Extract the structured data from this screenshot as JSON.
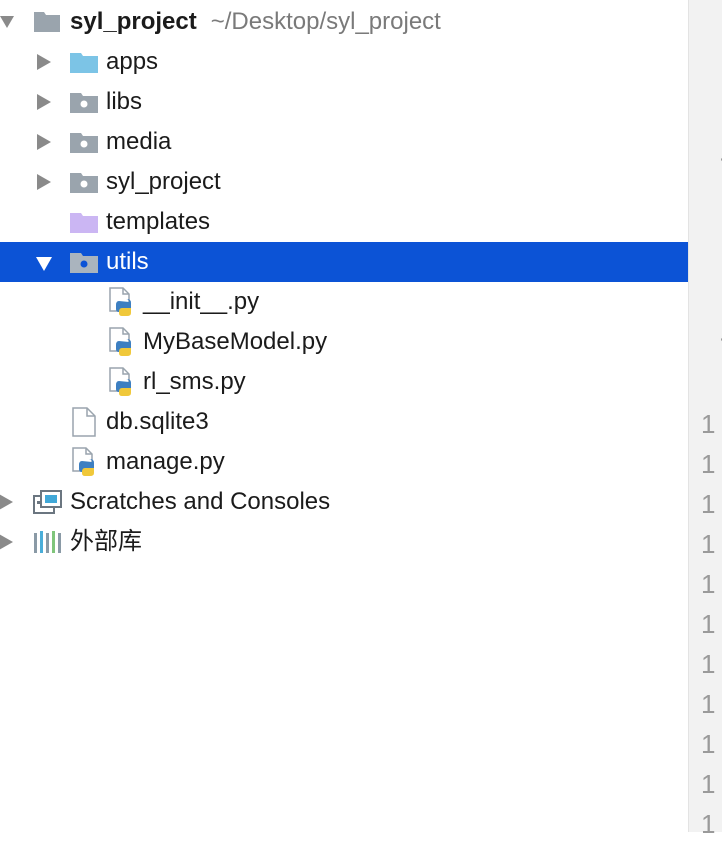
{
  "project_tree": {
    "root": {
      "name": "syl_project",
      "path": "~/Desktop/syl_project"
    },
    "items": [
      {
        "label": "apps"
      },
      {
        "label": "libs"
      },
      {
        "label": "media"
      },
      {
        "label": "syl_project"
      },
      {
        "label": "templates"
      },
      {
        "label": "utils"
      },
      {
        "label": "__init__.py"
      },
      {
        "label": "MyBaseModel.py"
      },
      {
        "label": "rl_sms.py"
      },
      {
        "label": "db.sqlite3"
      },
      {
        "label": "manage.py"
      },
      {
        "label": "Scratches and Consoles"
      },
      {
        "label": "外部库"
      }
    ],
    "selected_item": "utils"
  },
  "editor_gutter": {
    "line_numbers": [
      "1",
      "1",
      "1",
      "1",
      "1",
      "1",
      "1",
      "1",
      "1",
      "1",
      "1"
    ]
  },
  "colors": {
    "selection": "#0c53d6",
    "folder_gray": "#9aa4ad",
    "folder_blue": "#7cc4e6",
    "folder_purple": "#cbb6f3"
  }
}
